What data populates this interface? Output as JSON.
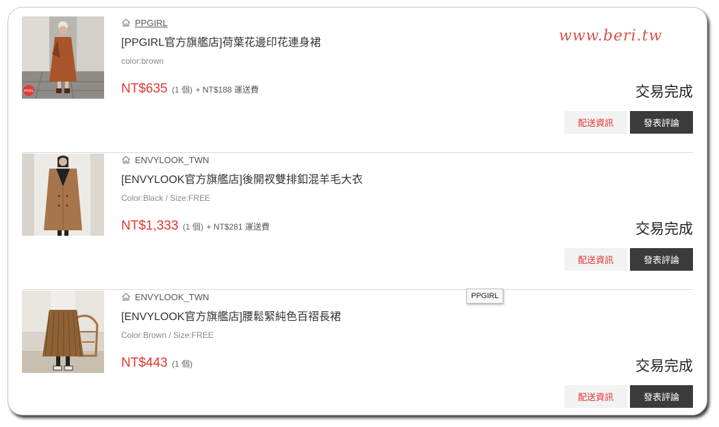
{
  "watermark": "www.beri.tw",
  "tooltip": "PPGIRL",
  "orders": [
    {
      "shop": "PPGIRL",
      "title": "[PPGIRL官方旗艦店]荷葉花邊印花連身裙",
      "variant": "color:brown",
      "price": "NT$635",
      "qty": "(1 個)",
      "shipping": "+ NT$188 運送費",
      "status": "交易完成",
      "ship_info_label": "配送資訊",
      "review_label": "發表評論"
    },
    {
      "shop": "ENVYLOOK_TWN",
      "title": "[ENVYLOOK官方旗艦店]後開衩雙排釦混羊毛大衣",
      "variant": "Color:Black / Size:FREE",
      "price": "NT$1,333",
      "qty": "(1 個)",
      "shipping": "+ NT$281 運送費",
      "status": "交易完成",
      "ship_info_label": "配送資訊",
      "review_label": "發表評論"
    },
    {
      "shop": "ENVYLOOK_TWN",
      "title": "[ENVYLOOK官方旗艦店]腰鬆緊純色百褶長裙",
      "variant": "Color:Brown / Size:FREE",
      "price": "NT$443",
      "qty": "(1 個)",
      "shipping": "",
      "status": "交易完成",
      "ship_info_label": "配送資訊",
      "review_label": "發表評論"
    }
  ],
  "colors": {
    "price": "#e4342f",
    "review_button": "#3b3b3b",
    "ship_button_bg": "#f2f2f2"
  }
}
